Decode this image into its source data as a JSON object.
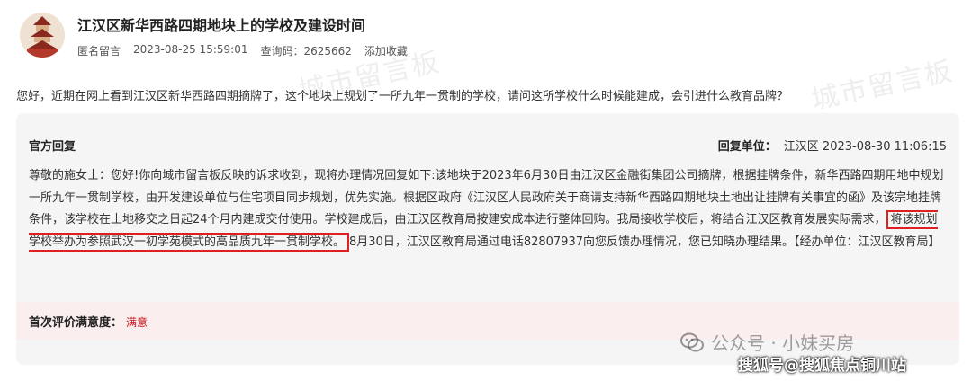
{
  "post": {
    "title": "江汉区新华西路四期地块上的学校及建设时间",
    "author": "匿名留言",
    "datetime": "2023-08-25 15:59:01",
    "views": "查询码：2625662",
    "bookmark": "添加收藏",
    "question": "您好，近期在网上看到江汉区新华西路四期摘牌了，这个地块上规划了一所九年一贯制的学校，请问这所学校什么时候能建成，会引进什么教育品牌？"
  },
  "reply": {
    "title": "官方回复",
    "unit_label": "回复单位：",
    "unit_value": "江汉区 2023-08-30 11:06:15",
    "body_before": "尊敬的施女士：您好!你向城市留言板反映的诉求收到，现将办理情况回复如下:该地块于2023年6月30日由江汉区金融街集团公司摘牌，根据挂牌条件，新华西路四期用地中规划一所九年一贯制学校，由开发建设单位与住宅项目同步规划，优先实施。根据区政府《江汉区人民政府关于商请支持新华西路四期地块土地出让挂牌有关事宜的函》及该宗地挂牌条件，该学校在土地移交之日起24个月内建成交付使用。学校建成后，由江汉区教育局按建安成本进行整体回购。我局接收学校后，将结合江汉区教育发展实际需求，",
    "body_highlight": "将该规划学校举办为参照武汉一初学苑模式的高品质九年一贯制学校。",
    "body_after": "8月30日，江汉区教育局通过电话82807937向您反馈办理情况，您已知晓办理结果。【经办单位：江汉区教育局】"
  },
  "rating": {
    "label": "首次评价满意度：",
    "value": "满意"
  },
  "overlays": {
    "watermark_text": "城市留言板",
    "wechat_account": "公众号 · 小妹买房",
    "sohu_credit": "搜狐号@搜狐焦点铜川站"
  },
  "colors": {
    "highlight_border": "#e02020",
    "rating_value": "#c8161d",
    "rating_bg": "#fbeeee",
    "reply_bg": "#f5f5f5"
  }
}
